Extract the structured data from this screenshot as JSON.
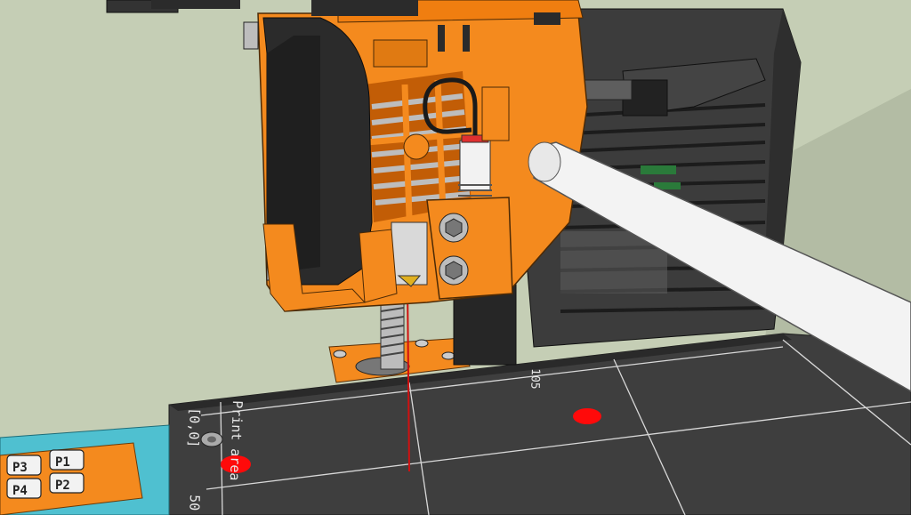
{
  "scene": {
    "description_labels": {
      "origin_label": "[0,0]",
      "print_area_label": "Print area",
      "y_tick_label": "50",
      "x_tick_label": "105"
    },
    "card_keys": [
      "P3",
      "P1",
      "P4",
      "P2"
    ],
    "colors": {
      "background": "#c5ceb5",
      "bed": "#3e3e3e",
      "grid_line": "#d8d8d8",
      "orange_part": "#f48a1e",
      "black_part": "#2b2b2b",
      "dark_gray_frame": "#3a3a3a",
      "filament": "#f3f3f3",
      "marker_red": "#ff0a0a",
      "cyan_plate": "#4fc0d0",
      "laser_red": "#d01010"
    },
    "icons": [
      "fan-icon",
      "hex-screw-icon",
      "threaded-rod-icon",
      "red-dot-marker-icon"
    ]
  }
}
